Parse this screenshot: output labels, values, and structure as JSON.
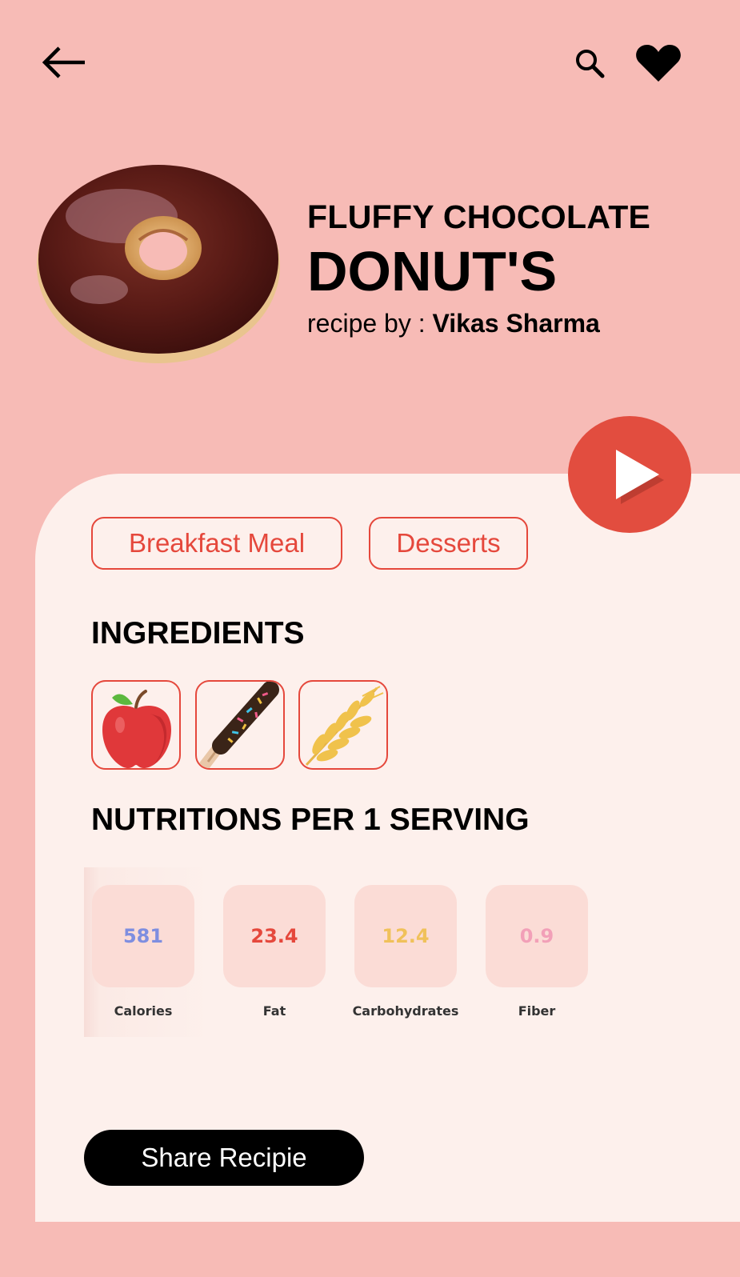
{
  "header": {
    "back_icon": "arrow-left-icon",
    "search_icon": "search-icon",
    "favorite_icon": "heart-icon"
  },
  "recipe": {
    "title_line1": "FLUFFY CHOCOLATE",
    "title_line2": "DONUT'S",
    "author_prefix": "recipe by : ",
    "author_name": "Vikas Sharma",
    "image": "chocolate-donut-image"
  },
  "play_icon": "play-icon",
  "tags": [
    "Breakfast Meal",
    "Desserts"
  ],
  "ingredients": {
    "heading": "INGREDIENTS",
    "items": [
      "apple-icon",
      "chocolate-stick-icon",
      "wheat-icon"
    ]
  },
  "nutrition": {
    "heading": "NUTRITIONS PER 1 SERVING",
    "items": [
      {
        "value": "581",
        "label": "Calories",
        "color": "#7e8ee0"
      },
      {
        "value": "23.4",
        "label": "Fat",
        "color": "#e5483c"
      },
      {
        "value": "12.4",
        "label": "Carbohydrates",
        "color": "#f0c15a"
      },
      {
        "value": "0.9",
        "label": "Fiber",
        "color": "#f2a0b8"
      }
    ]
  },
  "share": {
    "label": "Share Recipie"
  },
  "colors": {
    "background": "#f7bbb6",
    "card": "#fdf0ec",
    "accent": "#e5483c",
    "play": "#e24d3f"
  }
}
